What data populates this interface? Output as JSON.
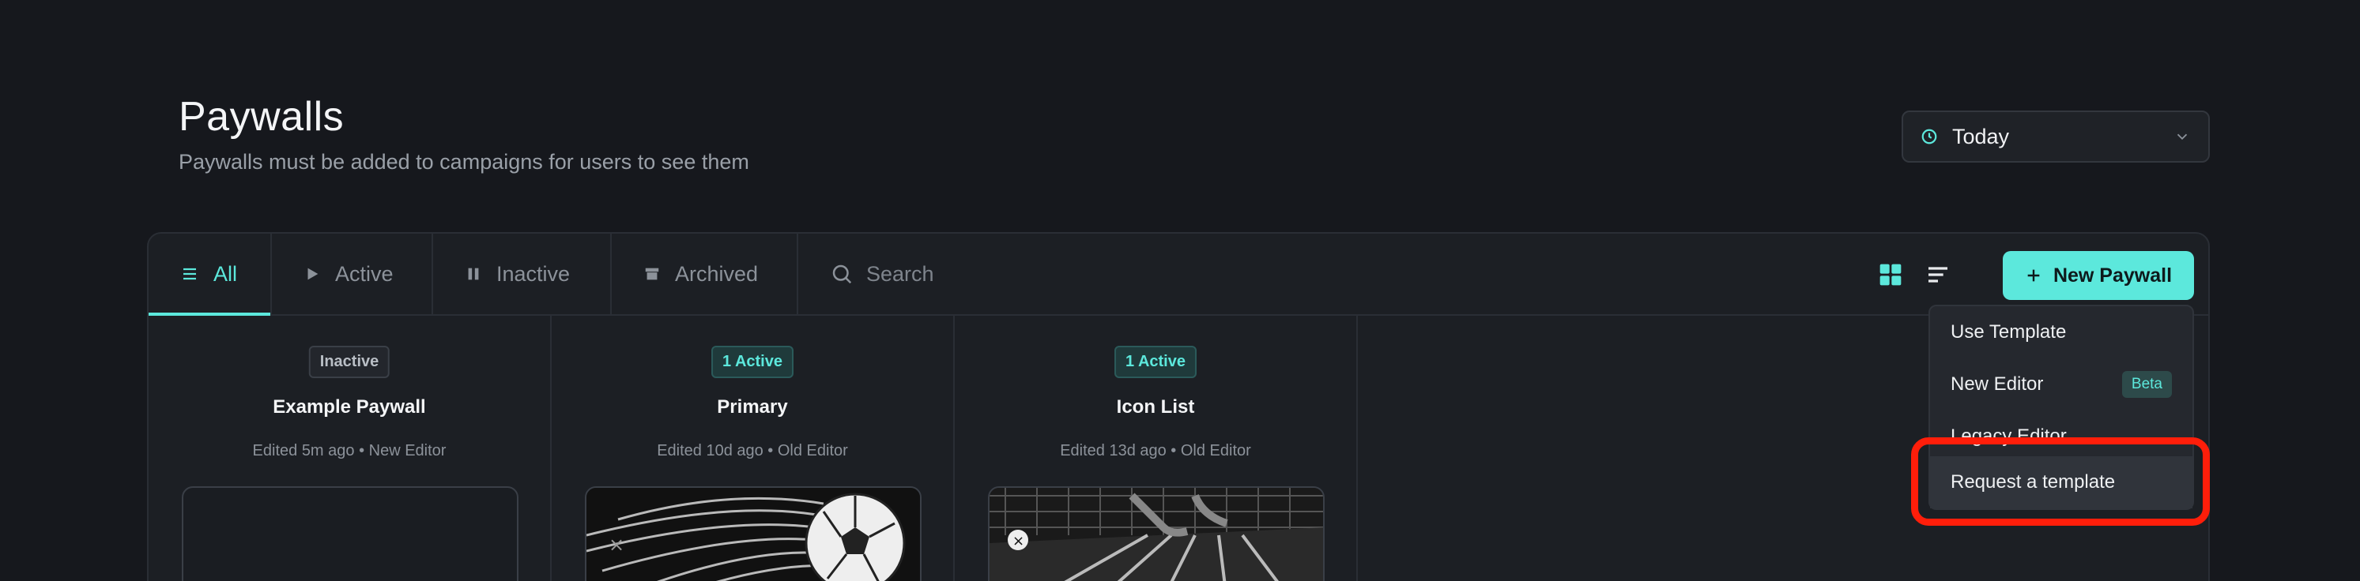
{
  "header": {
    "title": "Paywalls",
    "subtitle": "Paywalls must be added to campaigns for users to see them"
  },
  "date_filter": {
    "value": "Today"
  },
  "tabs": [
    {
      "label": "All",
      "active": true
    },
    {
      "label": "Active"
    },
    {
      "label": "Inactive"
    },
    {
      "label": "Archived"
    }
  ],
  "search": {
    "placeholder": "Search"
  },
  "new_paywall": {
    "label": "New Paywall"
  },
  "cards": [
    {
      "badge": "Inactive",
      "title": "Example Paywall",
      "meta": "Edited 5m ago • New Editor"
    },
    {
      "badge": "1 Active",
      "title": "Primary",
      "meta": "Edited 10d ago • Old Editor"
    },
    {
      "badge": "1 Active",
      "title": "Icon List",
      "meta": "Edited 13d ago • Old Editor"
    }
  ],
  "menu": {
    "items": [
      {
        "label": "Use Template"
      },
      {
        "label": "New Editor",
        "tag": "Beta"
      },
      {
        "label": "Legacy Editor"
      },
      {
        "label": "Request a template"
      }
    ]
  },
  "colors": {
    "accent": "#5ce8dc",
    "background": "#16181d",
    "highlight": "#ff1e0a"
  }
}
